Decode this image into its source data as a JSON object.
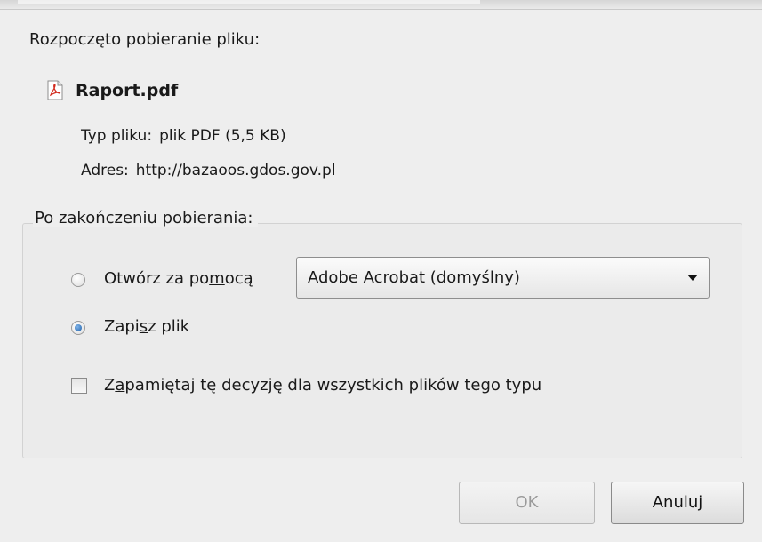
{
  "dialog": {
    "heading": "Rozpoczęto pobieranie pliku:",
    "file": {
      "icon": "pdf-file-icon",
      "name": "Raport.pdf",
      "type_label": "Typ pliku:",
      "type_value": "plik PDF (5,5 KB)",
      "address_label": "Adres:",
      "address_value": "http://bazaoos.gdos.gov.pl"
    },
    "after_download": {
      "legend": "Po zakończeniu pobierania:",
      "open_with": {
        "label_before": "Otwórz za po",
        "label_accel": "m",
        "label_after": "ocą",
        "checked": false
      },
      "application_select": {
        "value": "Adobe Acrobat  (domyślny)"
      },
      "save_file": {
        "label_before": "Zapi",
        "label_accel": "s",
        "label_after": "z plik",
        "checked": true
      },
      "remember": {
        "label_before": "Z",
        "label_accel": "a",
        "label_after": "pamiętaj tę decyzję dla wszystkich plików tego typu",
        "checked": false
      }
    },
    "buttons": {
      "ok": "OK",
      "cancel": "Anuluj"
    },
    "colors": {
      "background": "#eeeeee",
      "radio_selected": "#1d5fa8",
      "disabled_text": "#9a9a9a"
    }
  }
}
